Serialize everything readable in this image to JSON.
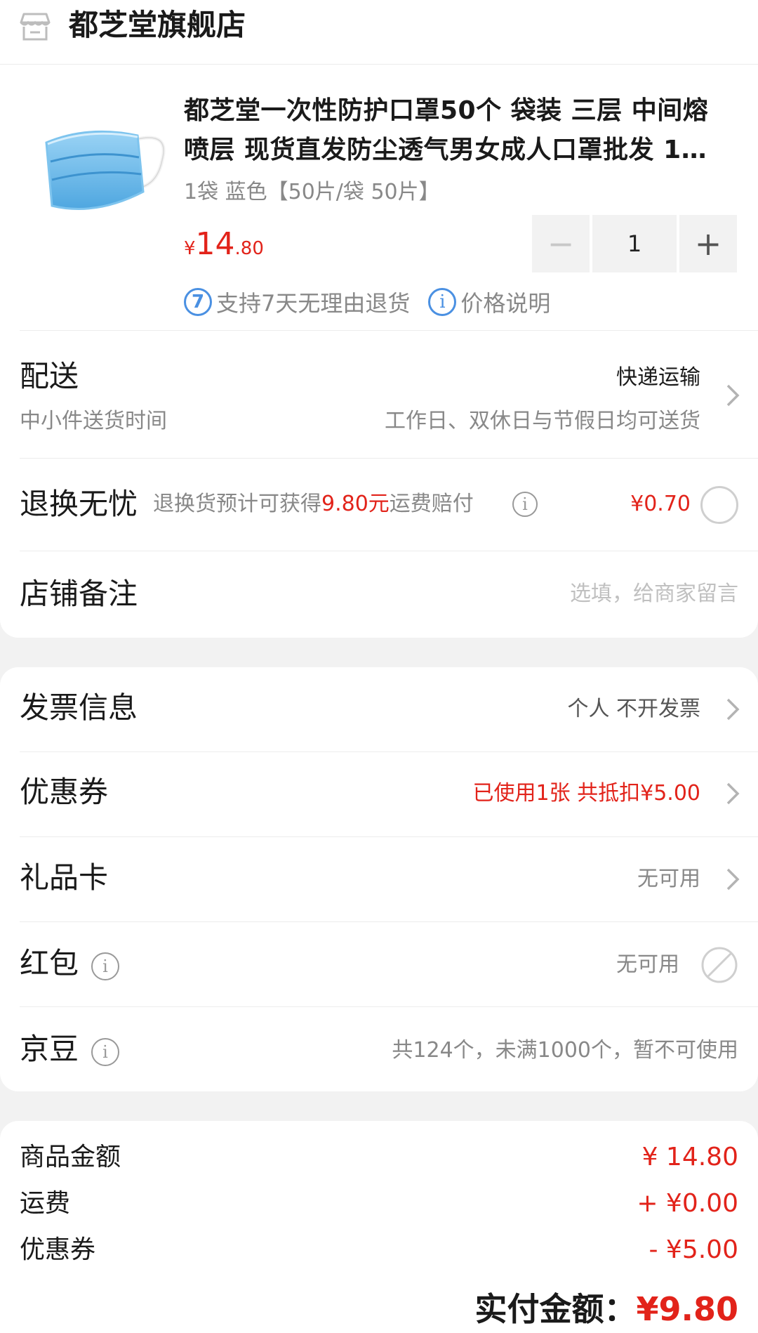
{
  "store": {
    "icon": "store-icon",
    "name": "都芝堂旗舰店"
  },
  "product": {
    "image": "face-mask-image",
    "title": "都芝堂一次性防护口罩50个 袋装 三层 中间熔喷层 现货直发防尘透气男女成人口罩批发 1…",
    "spec": "1袋 蓝色【50片/袋 50片】",
    "price_symbol": "¥",
    "price_int": "14",
    "price_dec": ".80",
    "quantity": "1",
    "minus": "−",
    "plus": "+",
    "badge_7": "7",
    "return_text": "支持7天无理由退货",
    "badge_i": "i",
    "price_note": "价格说明"
  },
  "delivery": {
    "label": "配送",
    "value": "快递运输",
    "sub_label": "中小件送货时间",
    "sub_value": "工作日、双休日与节假日均可送货"
  },
  "return_insurance": {
    "label": "退换无忧",
    "desc_prefix": "退换货预计可获得",
    "desc_amount": "9.80元",
    "desc_suffix": "运费赔付",
    "price": "¥0.70",
    "selected": false
  },
  "remark": {
    "label": "店铺备注",
    "placeholder": "选填，给商家留言"
  },
  "invoice": {
    "label": "发票信息",
    "value": "个人 不开发票"
  },
  "coupon": {
    "label": "优惠券",
    "value": "已使用1张 共抵扣¥5.00"
  },
  "gift_card": {
    "label": "礼品卡",
    "value": "无可用"
  },
  "red_packet": {
    "label": "红包",
    "value": "无可用"
  },
  "jingdou": {
    "label": "京豆",
    "value": "共124个，未满1000个，暂不可使用"
  },
  "info_glyph": "i",
  "summary": {
    "goods_label": "商品金额",
    "goods_value": "¥ 14.80",
    "shipping_label": "运费",
    "shipping_value": "+ ¥0.00",
    "coupon_label": "优惠券",
    "coupon_value": "- ¥5.00",
    "total_label": "实付金额：",
    "total_value": "¥9.80"
  },
  "colors": {
    "accent_red": "#e2231a",
    "badge_blue": "#4a90e2"
  }
}
